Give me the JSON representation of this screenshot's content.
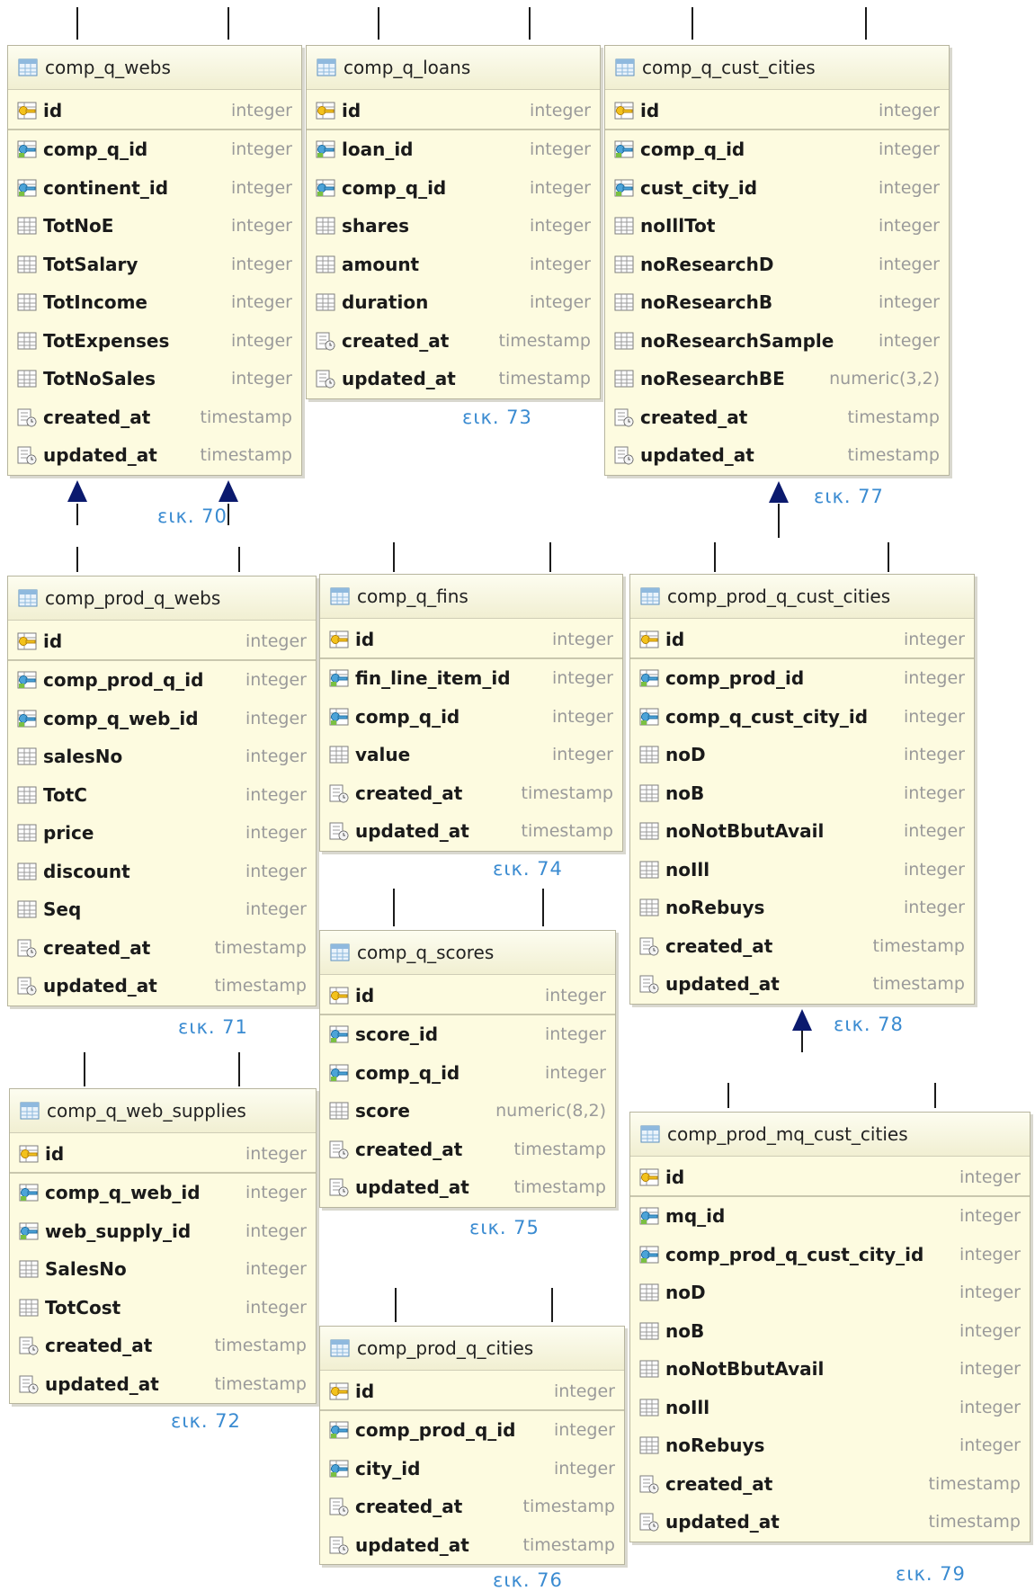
{
  "tables": [
    {
      "name": "comp_q_webs",
      "figure": "εικ. 70",
      "columns": [
        {
          "name": "id",
          "type": "integer",
          "key": "pk"
        },
        {
          "name": "comp_q_id",
          "type": "integer",
          "key": "fk"
        },
        {
          "name": "continent_id",
          "type": "integer",
          "key": "fk"
        },
        {
          "name": "TotNoE",
          "type": "integer",
          "key": "col"
        },
        {
          "name": "TotSalary",
          "type": "integer",
          "key": "col"
        },
        {
          "name": "TotIncome",
          "type": "integer",
          "key": "col"
        },
        {
          "name": "TotExpenses",
          "type": "integer",
          "key": "col"
        },
        {
          "name": "TotNoSales",
          "type": "integer",
          "key": "col"
        },
        {
          "name": "created_at",
          "type": "timestamp",
          "key": "ts"
        },
        {
          "name": "updated_at",
          "type": "timestamp",
          "key": "ts"
        }
      ]
    },
    {
      "name": "comp_q_loans",
      "figure": "εικ. 73",
      "columns": [
        {
          "name": "id",
          "type": "integer",
          "key": "pk"
        },
        {
          "name": "loan_id",
          "type": "integer",
          "key": "fk"
        },
        {
          "name": "comp_q_id",
          "type": "integer",
          "key": "fk"
        },
        {
          "name": "shares",
          "type": "integer",
          "key": "col"
        },
        {
          "name": "amount",
          "type": "integer",
          "key": "col"
        },
        {
          "name": "duration",
          "type": "integer",
          "key": "col"
        },
        {
          "name": "created_at",
          "type": "timestamp",
          "key": "ts"
        },
        {
          "name": "updated_at",
          "type": "timestamp",
          "key": "ts"
        }
      ]
    },
    {
      "name": "comp_q_cust_cities",
      "figure": "εικ. 77",
      "columns": [
        {
          "name": "id",
          "type": "integer",
          "key": "pk"
        },
        {
          "name": "comp_q_id",
          "type": "integer",
          "key": "fk"
        },
        {
          "name": "cust_city_id",
          "type": "integer",
          "key": "fk"
        },
        {
          "name": "noIllTot",
          "type": "integer",
          "key": "col"
        },
        {
          "name": "noResearchD",
          "type": "integer",
          "key": "col"
        },
        {
          "name": "noResearchB",
          "type": "integer",
          "key": "col"
        },
        {
          "name": "noResearchSample",
          "type": "integer",
          "key": "col"
        },
        {
          "name": "noResearchBE",
          "type": "numeric(3,2)",
          "key": "col"
        },
        {
          "name": "created_at",
          "type": "timestamp",
          "key": "ts"
        },
        {
          "name": "updated_at",
          "type": "timestamp",
          "key": "ts"
        }
      ]
    },
    {
      "name": "comp_prod_q_webs",
      "figure": "εικ. 71",
      "columns": [
        {
          "name": "id",
          "type": "integer",
          "key": "pk"
        },
        {
          "name": "comp_prod_q_id",
          "type": "integer",
          "key": "fk"
        },
        {
          "name": "comp_q_web_id",
          "type": "integer",
          "key": "fk"
        },
        {
          "name": "salesNo",
          "type": "integer",
          "key": "col"
        },
        {
          "name": "TotC",
          "type": "integer",
          "key": "col"
        },
        {
          "name": "price",
          "type": "integer",
          "key": "col"
        },
        {
          "name": "discount",
          "type": "integer",
          "key": "col"
        },
        {
          "name": "Seq",
          "type": "integer",
          "key": "col"
        },
        {
          "name": "created_at",
          "type": "timestamp",
          "key": "ts"
        },
        {
          "name": "updated_at",
          "type": "timestamp",
          "key": "ts"
        }
      ]
    },
    {
      "name": "comp_q_fins",
      "figure": "εικ. 74",
      "columns": [
        {
          "name": "id",
          "type": "integer",
          "key": "pk"
        },
        {
          "name": "fin_line_item_id",
          "type": "integer",
          "key": "fk"
        },
        {
          "name": "comp_q_id",
          "type": "integer",
          "key": "fk"
        },
        {
          "name": "value",
          "type": "integer",
          "key": "col"
        },
        {
          "name": "created_at",
          "type": "timestamp",
          "key": "ts"
        },
        {
          "name": "updated_at",
          "type": "timestamp",
          "key": "ts"
        }
      ]
    },
    {
      "name": "comp_prod_q_cust_cities",
      "figure": "εικ. 78",
      "columns": [
        {
          "name": "id",
          "type": "integer",
          "key": "pk"
        },
        {
          "name": "comp_prod_id",
          "type": "integer",
          "key": "fk"
        },
        {
          "name": "comp_q_cust_city_id",
          "type": "integer",
          "key": "fk"
        },
        {
          "name": "noD",
          "type": "integer",
          "key": "col"
        },
        {
          "name": "noB",
          "type": "integer",
          "key": "col"
        },
        {
          "name": "noNotBbutAvail",
          "type": "integer",
          "key": "col"
        },
        {
          "name": "noIll",
          "type": "integer",
          "key": "col"
        },
        {
          "name": "noRebuys",
          "type": "integer",
          "key": "col"
        },
        {
          "name": "created_at",
          "type": "timestamp",
          "key": "ts"
        },
        {
          "name": "updated_at",
          "type": "timestamp",
          "key": "ts"
        }
      ]
    },
    {
      "name": "comp_q_scores",
      "figure": "εικ. 75",
      "columns": [
        {
          "name": "id",
          "type": "integer",
          "key": "pk"
        },
        {
          "name": "score_id",
          "type": "integer",
          "key": "fk"
        },
        {
          "name": "comp_q_id",
          "type": "integer",
          "key": "fk"
        },
        {
          "name": "score",
          "type": "numeric(8,2)",
          "key": "col"
        },
        {
          "name": "created_at",
          "type": "timestamp",
          "key": "ts"
        },
        {
          "name": "updated_at",
          "type": "timestamp",
          "key": "ts"
        }
      ]
    },
    {
      "name": "comp_q_web_supplies",
      "figure": "εικ. 72",
      "columns": [
        {
          "name": "id",
          "type": "integer",
          "key": "pk"
        },
        {
          "name": "comp_q_web_id",
          "type": "integer",
          "key": "fk"
        },
        {
          "name": "web_supply_id",
          "type": "integer",
          "key": "fk"
        },
        {
          "name": "SalesNo",
          "type": "integer",
          "key": "col"
        },
        {
          "name": "TotCost",
          "type": "integer",
          "key": "col"
        },
        {
          "name": "created_at",
          "type": "timestamp",
          "key": "ts"
        },
        {
          "name": "updated_at",
          "type": "timestamp",
          "key": "ts"
        }
      ]
    },
    {
      "name": "comp_prod_mq_cust_cities",
      "figure": "εικ. 79",
      "columns": [
        {
          "name": "id",
          "type": "integer",
          "key": "pk"
        },
        {
          "name": "mq_id",
          "type": "integer",
          "key": "fk"
        },
        {
          "name": "comp_prod_q_cust_city_id",
          "type": "integer",
          "key": "fk"
        },
        {
          "name": "noD",
          "type": "integer",
          "key": "col"
        },
        {
          "name": "noB",
          "type": "integer",
          "key": "col"
        },
        {
          "name": "noNotBbutAvail",
          "type": "integer",
          "key": "col"
        },
        {
          "name": "noIll",
          "type": "integer",
          "key": "col"
        },
        {
          "name": "noRebuys",
          "type": "integer",
          "key": "col"
        },
        {
          "name": "created_at",
          "type": "timestamp",
          "key": "ts"
        },
        {
          "name": "updated_at",
          "type": "timestamp",
          "key": "ts"
        }
      ]
    },
    {
      "name": "comp_prod_q_cities",
      "figure": "εικ. 76",
      "columns": [
        {
          "name": "id",
          "type": "integer",
          "key": "pk"
        },
        {
          "name": "comp_prod_q_id",
          "type": "integer",
          "key": "fk"
        },
        {
          "name": "city_id",
          "type": "integer",
          "key": "fk"
        },
        {
          "name": "created_at",
          "type": "timestamp",
          "key": "ts"
        },
        {
          "name": "updated_at",
          "type": "timestamp",
          "key": "ts"
        }
      ]
    }
  ],
  "colors": {
    "table_bg": "#fdfbe0",
    "figure_label": "#3a8bd1",
    "arrow": "#0b1a6e"
  }
}
